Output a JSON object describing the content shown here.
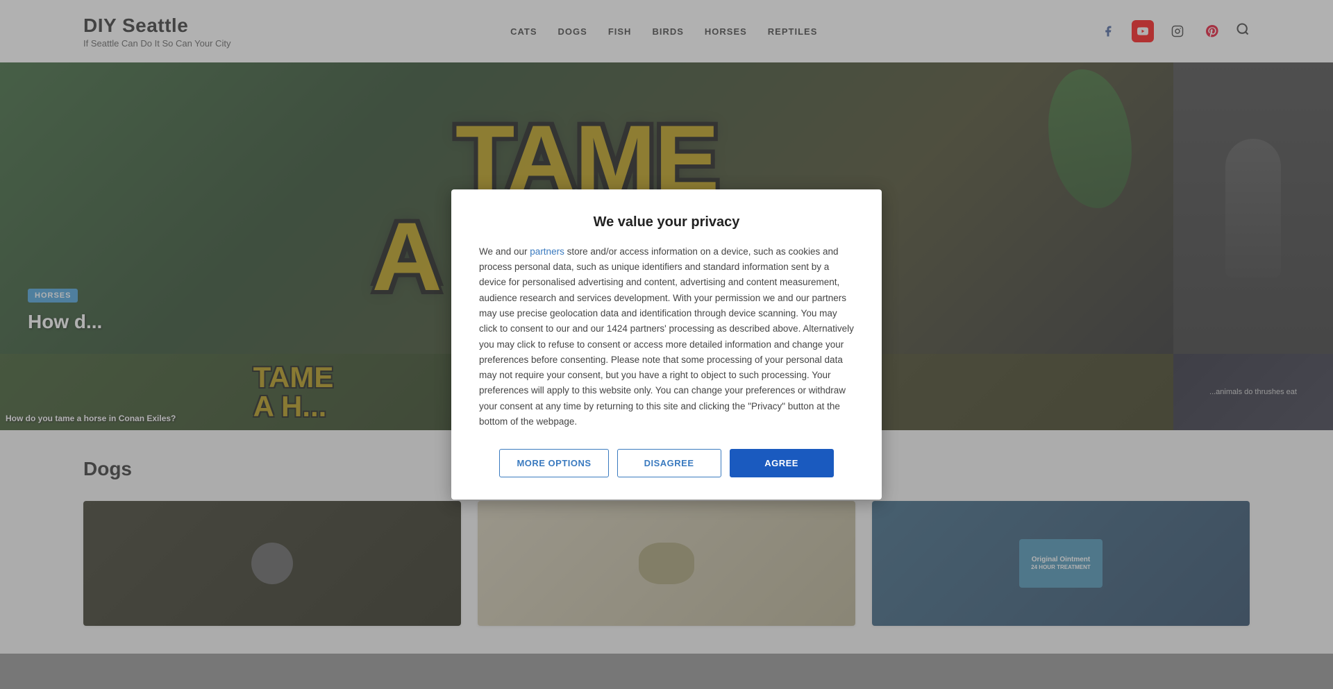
{
  "header": {
    "logo_title": "DIY Seattle",
    "logo_subtitle": "If Seattle Can Do It So Can Your City",
    "nav": [
      {
        "label": "CATS",
        "id": "cats"
      },
      {
        "label": "DOGS",
        "id": "dogs"
      },
      {
        "label": "FISH",
        "id": "fish"
      },
      {
        "label": "BIRDS",
        "id": "birds"
      },
      {
        "label": "HORSES",
        "id": "horses"
      },
      {
        "label": "REPTILES",
        "id": "reptiles"
      }
    ]
  },
  "hero": {
    "badge": "HORSES",
    "tame_line1": "TAME",
    "tame_line2": "A HORSE",
    "article_title": "How d...",
    "article_caption_1": "How do you tame a horse in Conan Exiles?",
    "article_caption_2": "...animals do thrushes eat"
  },
  "dogs_section": {
    "title": "Dogs"
  },
  "modal": {
    "title": "We value your privacy",
    "body_intro": "We and our ",
    "partners_link": "partners",
    "body_text": " store and/or access information on a device, such as cookies and process personal data, such as unique identifiers and standard information sent by a device for personalised advertising and content, advertising and content measurement, audience research and services development. With your permission we and our partners may use precise geolocation data and identification through device scanning. You may click to consent to our and our 1424 partners' processing as described above. Alternatively you may click to refuse to consent or access more detailed information and change your preferences before consenting. Please note that some processing of your personal data may not require your consent, but you have a right to object to such processing. Your preferences will apply to this website only. You can change your preferences or withdraw your consent at any time by returning to this site and clicking the \"Privacy\" button at the bottom of the webpage.",
    "btn_more": "MORE OPTIONS",
    "btn_disagree": "DISAGREE",
    "btn_agree": "AGREE"
  }
}
